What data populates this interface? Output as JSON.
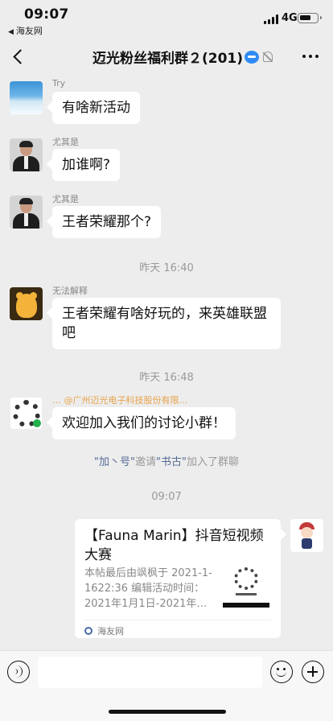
{
  "status_bar": {
    "time": "09:07",
    "back_app": "海友网",
    "network": "4G",
    "battery_level": 0.7
  },
  "nav": {
    "title": "迈光粉丝福利群２(201)",
    "back_icon": "chevron-left-icon",
    "more_icon": "more-dots-icon"
  },
  "messages": [
    {
      "sender": "Try",
      "text": "有啥新活动"
    },
    {
      "sender": "尤其是",
      "text": "加谁啊?"
    },
    {
      "sender": "尤其是",
      "text": "王者荣耀那个?"
    },
    {
      "sender": "无法解释",
      "text_line1": "王者荣耀有啥好玩的，来英雄联盟",
      "text_line2": "吧"
    },
    {
      "sender": "… @广州迈光电子科技股份有限…",
      "text": "欢迎加入我们的讨论小群！"
    }
  ],
  "timestamps": {
    "t1": "昨天 16:40",
    "t2": "昨天 16:48",
    "t3": "09:07"
  },
  "system_note": {
    "inviter": "\"加丶号\"",
    "action": "邀请",
    "invitee": "\"书古\"",
    "suffix": "加入了群聊"
  },
  "card": {
    "title": "【Fauna Marin】抖音短视频大赛",
    "description": "本帖最后由飒枫于 2021-1-1622:36 编辑活动时间：2021年1月1日-2021年…",
    "source": "海友网"
  },
  "input": {
    "placeholder": ""
  },
  "colors": {
    "background": "#ededed",
    "bubble": "#ffffff",
    "link": "#576b95"
  }
}
